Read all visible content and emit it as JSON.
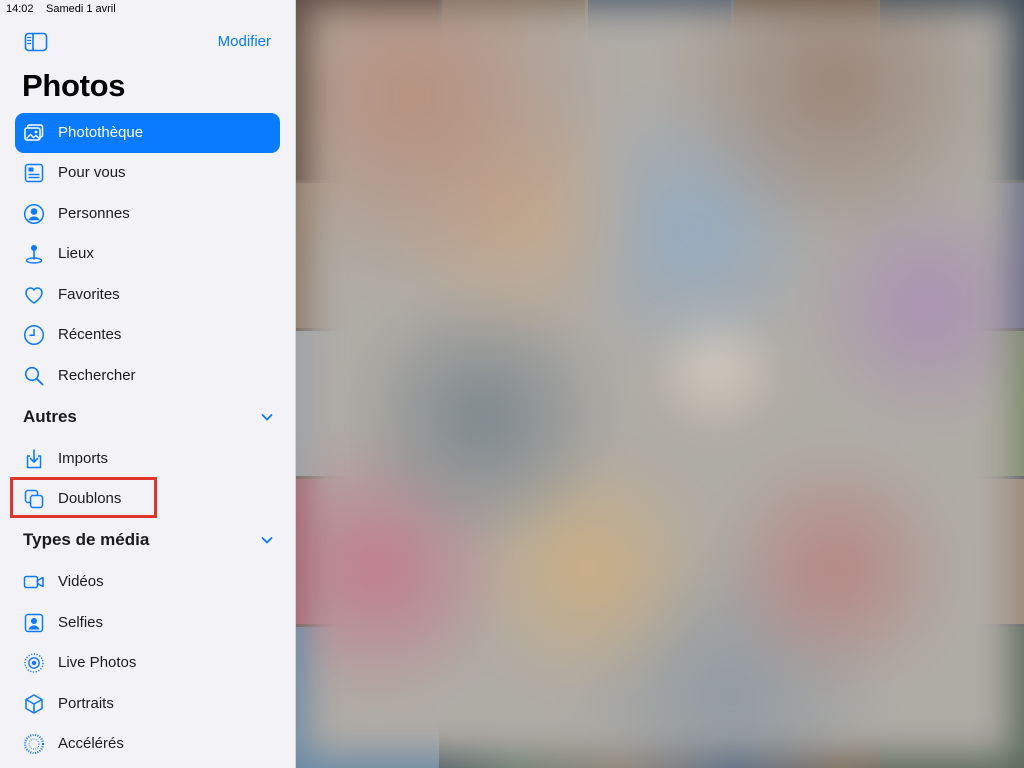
{
  "status_bar": {
    "time": "14:02",
    "date": "Samedi 1 avril"
  },
  "sidebar": {
    "edit_label": "Modifier",
    "title": "Photos",
    "primary_items": [
      {
        "label": "Photothèque",
        "icon": "photo-library-icon",
        "selected": true
      },
      {
        "label": "Pour vous",
        "icon": "for-you-icon"
      },
      {
        "label": "Personnes",
        "icon": "person-icon"
      },
      {
        "label": "Lieux",
        "icon": "map-pin-icon"
      },
      {
        "label": "Favorites",
        "icon": "heart-icon"
      },
      {
        "label": "Récentes",
        "icon": "clock-icon"
      },
      {
        "label": "Rechercher",
        "icon": "search-icon"
      }
    ],
    "sections": [
      {
        "title": "Autres",
        "items": [
          {
            "label": "Imports",
            "icon": "import-icon"
          },
          {
            "label": "Doublons",
            "icon": "duplicates-icon",
            "highlighted": true
          }
        ]
      },
      {
        "title": "Types de média",
        "items": [
          {
            "label": "Vidéos",
            "icon": "video-icon"
          },
          {
            "label": "Selfies",
            "icon": "selfie-icon"
          },
          {
            "label": "Live Photos",
            "icon": "live-photo-icon"
          },
          {
            "label": "Portraits",
            "icon": "cube-icon"
          },
          {
            "label": "Accélérés",
            "icon": "timelapse-icon"
          }
        ]
      }
    ]
  },
  "colors": {
    "accent": "#0a7aff",
    "highlight": "#e0352b",
    "sidebar_bg": "#f2f2f7"
  }
}
